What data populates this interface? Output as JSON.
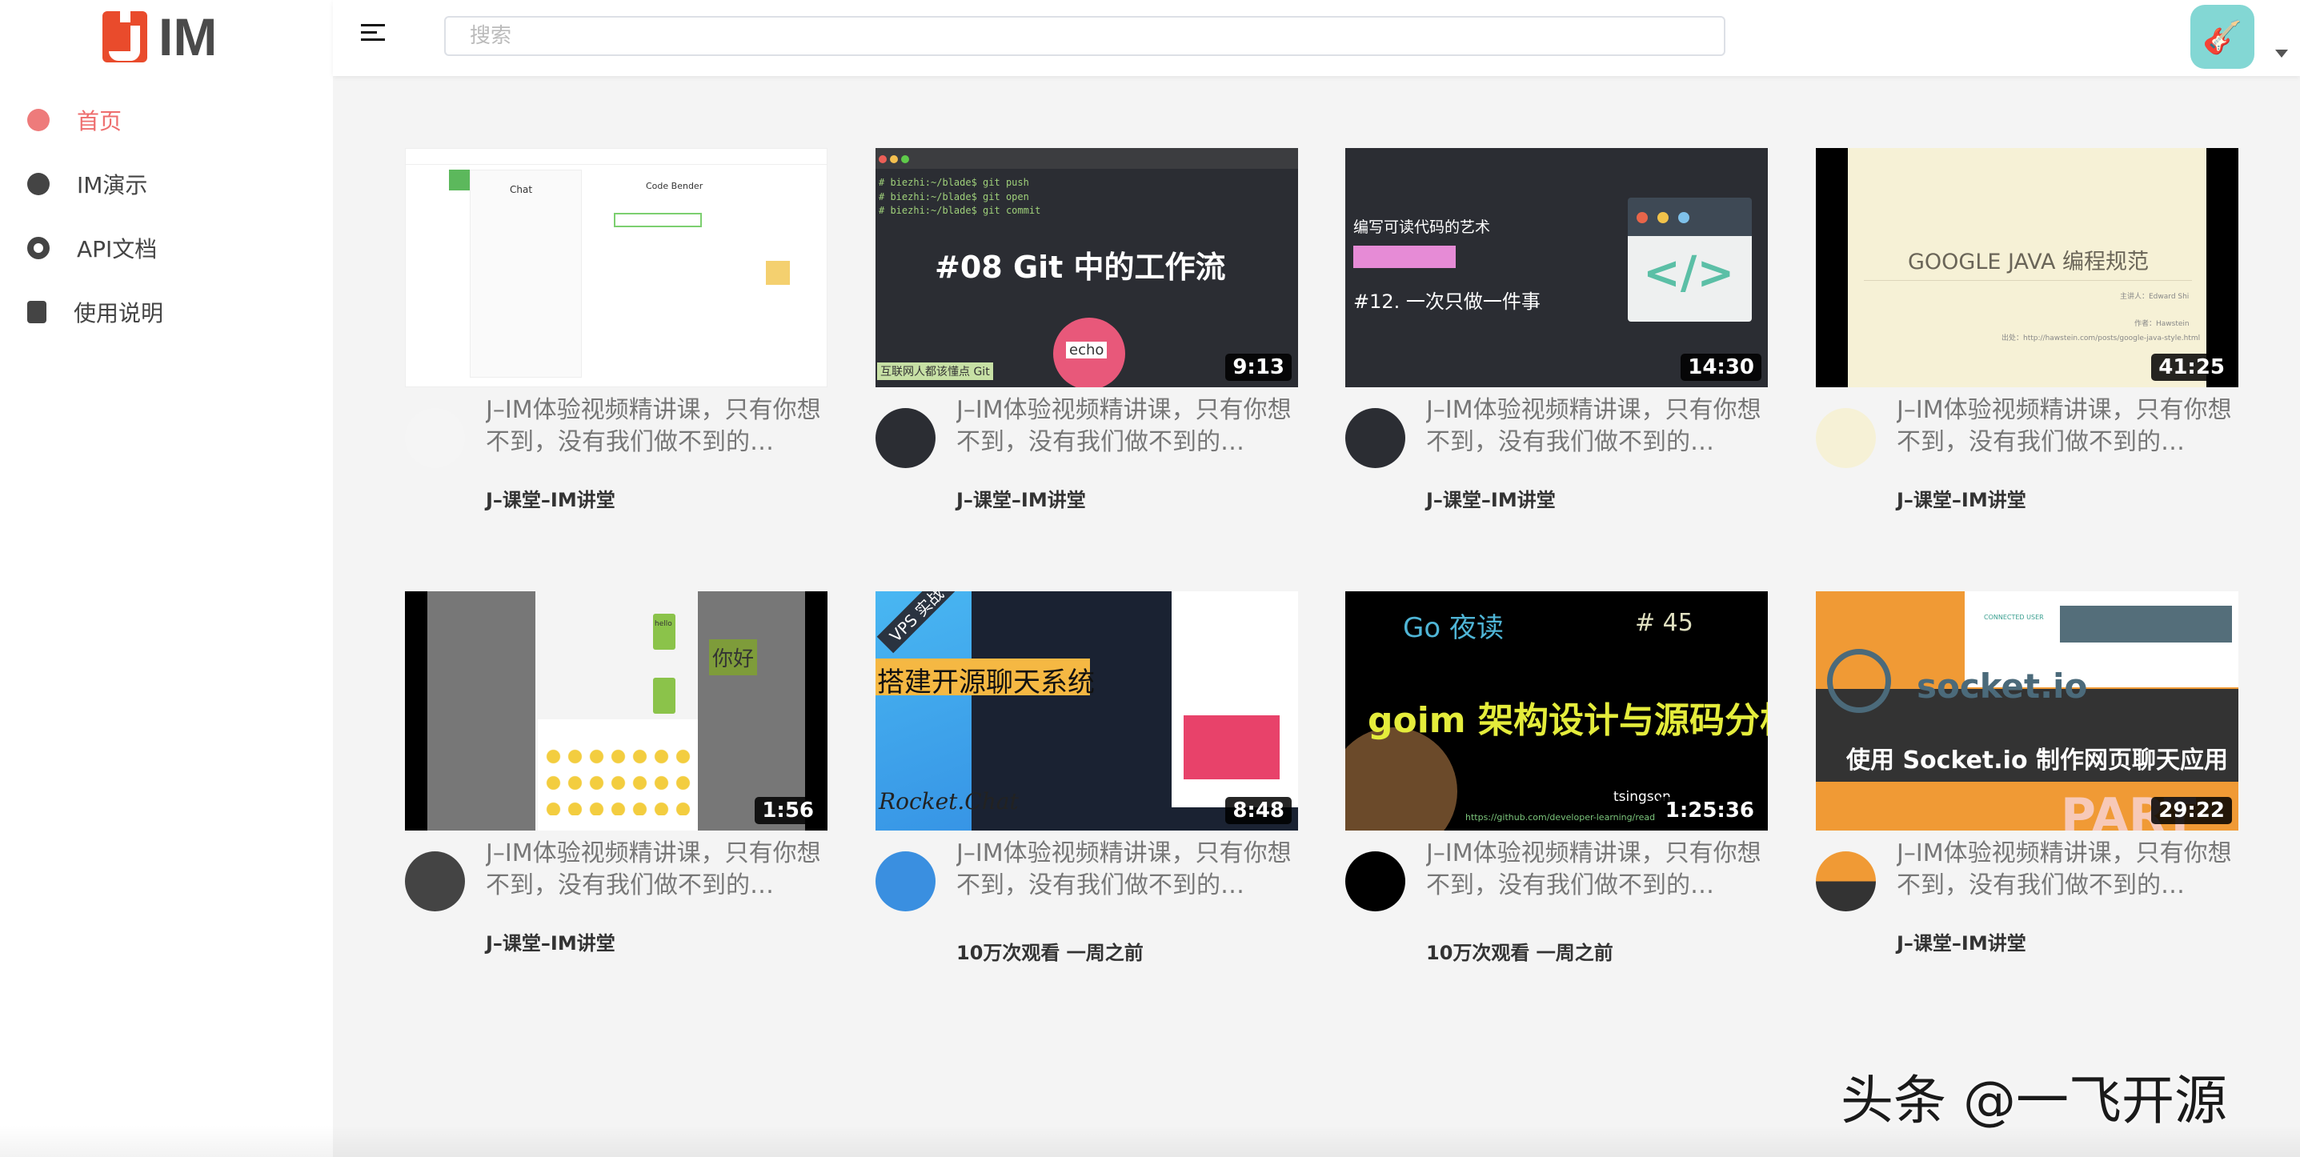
{
  "app": {
    "logo_text": "IM",
    "logo_letter": "J"
  },
  "sidebar": {
    "items": [
      {
        "label": "首页",
        "icon": "dashboard-icon",
        "active": true
      },
      {
        "label": "IM演示",
        "icon": "dashboard-icon",
        "active": false
      },
      {
        "label": "API文档",
        "icon": "lifebuoy-icon",
        "active": false
      },
      {
        "label": "使用说明",
        "icon": "document-edit-icon",
        "active": false
      }
    ]
  },
  "header": {
    "search_placeholder": "搜索",
    "accent": "#ee6e6e"
  },
  "videos": [
    {
      "title": "J–IM体验视频精讲课，只有你想不到，没有我们做不到的…",
      "channel": "J–课堂–IM讲堂",
      "duration": "",
      "thumb_text": [
        "Chat",
        "Code Bender"
      ]
    },
    {
      "title": "J–IM体验视频精讲课，只有你想不到，没有我们做不到的…",
      "channel": "J–课堂–IM讲堂",
      "duration": "9:13",
      "thumb_text": [
        "# biezhi:~/blade$ git push",
        "# biezhi:~/blade$ git open",
        "# biezhi:~/blade$ git commit",
        "#08 Git 中的工作流",
        "互联网人都该懂点 Git",
        "echo"
      ]
    },
    {
      "title": "J–IM体验视频精讲课，只有你想不到，没有我们做不到的…",
      "channel": "J–课堂–IM讲堂",
      "duration": "14:30",
      "thumb_text": [
        "编写可读代码的艺术",
        "#12. 一次只做一件事",
        "</>"
      ]
    },
    {
      "title": "J–IM体验视频精讲课，只有你想不到，没有我们做不到的…",
      "channel": "J–课堂–IM讲堂",
      "duration": "41:25",
      "thumb_text": [
        "GOOGLE JAVA 编程规范",
        "主讲人：Edward Shi",
        "作者：Hawstein",
        "出处：http://hawstein.com/posts/google-java-style.html"
      ]
    },
    {
      "title": "J–IM体验视频精讲课，只有你想不到，没有我们做不到的…",
      "channel": "J–课堂–IM讲堂",
      "duration": "1:56",
      "thumb_text": [
        "hello",
        "你好"
      ]
    },
    {
      "title": "J–IM体验视频精讲课，只有你想不到，没有我们做不到的…",
      "views": "10万次观看 一周之前",
      "duration": "8:48",
      "thumb_text": [
        "VPS 实战",
        "搭建开源聊天系统",
        "Rocket.Chat"
      ]
    },
    {
      "title": "J–IM体验视频精讲课，只有你想不到，没有我们做不到的…",
      "views": "10万次观看 一周之前",
      "duration": "1:25:36",
      "thumb_text": [
        "Go 夜读",
        "# 45",
        "goim 架构设计与源码分析",
        "tsingson",
        "https://github.com/developer-learning/read"
      ]
    },
    {
      "title": "J–IM体验视频精讲课，只有你想不到，没有我们做不到的…",
      "channel": "J–课堂–IM讲堂",
      "duration": "29:22",
      "thumb_text": [
        "socket.io",
        "使用 Socket.io 制作网页聊天应用",
        "CONNECTED USER",
        "PART"
      ]
    }
  ],
  "watermark": "头条 @一飞开源"
}
